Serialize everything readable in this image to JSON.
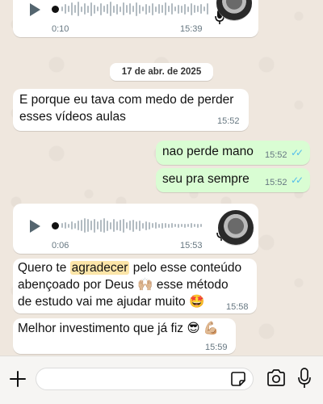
{
  "conversation": {
    "voice_message_1": {
      "duration": "0:10",
      "time": "15:39"
    },
    "date_separator": "17 de abr. de 2025",
    "messages": [
      {
        "text_line1": "E porque eu tava com medo de perder",
        "text_line2": "esses vídeos aulas",
        "time": "15:52",
        "direction": "incoming"
      },
      {
        "text": "nao perde mano",
        "time": "15:52",
        "direction": "outgoing",
        "status": "read"
      },
      {
        "text": "seu pra sempre",
        "time": "15:52",
        "direction": "outgoing",
        "status": "read"
      }
    ],
    "voice_message_2": {
      "duration": "0:06",
      "time": "15:53"
    },
    "message_long": {
      "part1": "Quero te ",
      "highlighted": "agradecer",
      "part2": " pelo esse conteúdo",
      "line2_a": "abençoado por Deus ",
      "emoji_pray": "🙌🏼",
      "line2_b": " esse método",
      "line3": "de estudo vai me ajudar muito ",
      "emoji_smile": "🤩",
      "time": "15:58"
    },
    "message_last": {
      "text": "Melhor investimento que já fiz ",
      "emoji_a": "😎",
      "emoji_b": "💪🏼",
      "time": "15:59"
    }
  },
  "composer": {
    "add_icon": "plus-icon",
    "sticker_icon": "sticker-icon",
    "camera_icon": "camera-icon",
    "mic_icon": "mic-icon"
  },
  "colors": {
    "outgoing_bubble": "#d9fdd3",
    "incoming_bubble": "#ffffff",
    "read_ticks": "#53bdeb",
    "background": "#efe7de"
  }
}
